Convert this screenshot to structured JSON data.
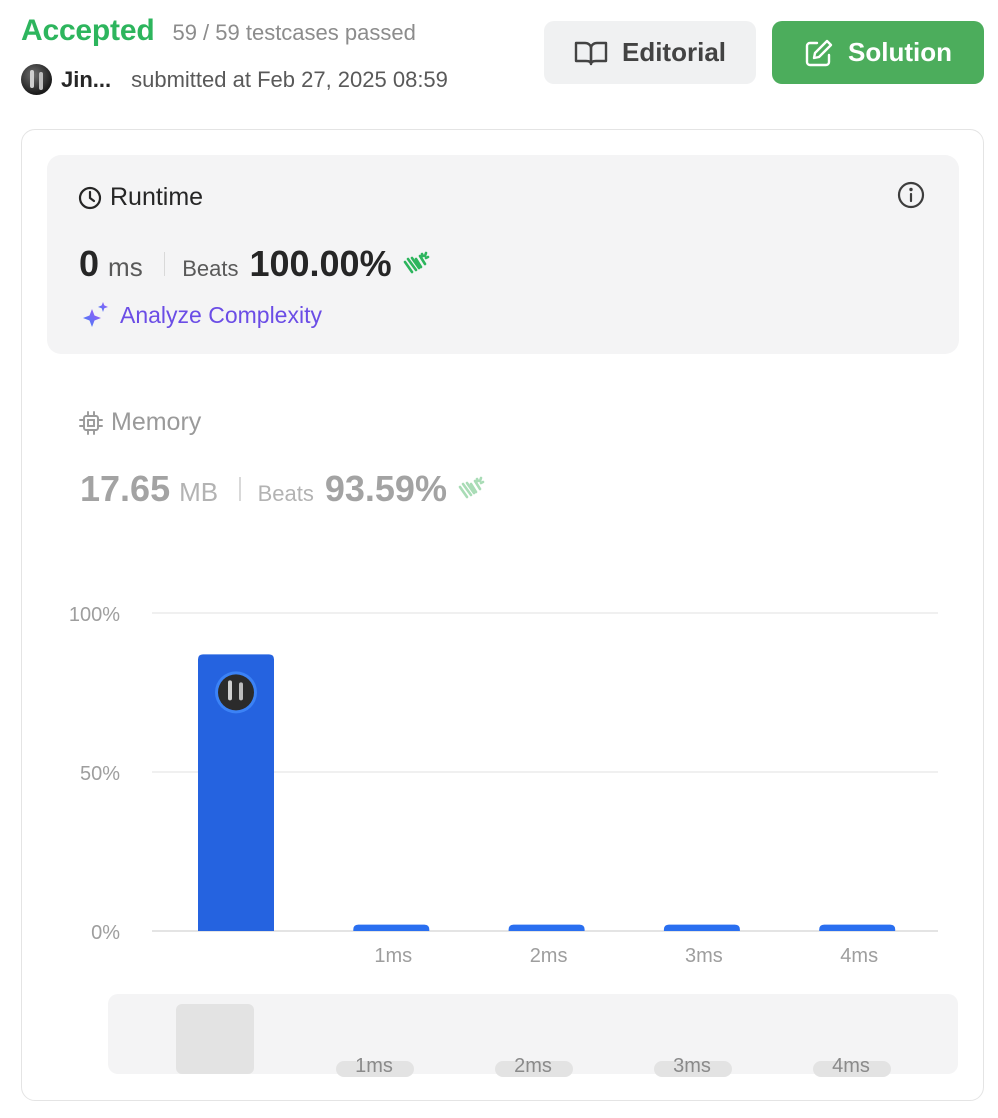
{
  "header": {
    "status": "Accepted",
    "testcases": "59 / 59 testcases passed",
    "username": "Jin...",
    "submitted": "submitted at Feb 27, 2025 08:59",
    "editorial_label": "Editorial",
    "solution_label": "Solution"
  },
  "runtime": {
    "title": "Runtime",
    "value": "0",
    "unit": "ms",
    "beats_label": "Beats",
    "beats_value": "100.00%",
    "analyze_label": "Analyze Complexity"
  },
  "memory": {
    "title": "Memory",
    "value": "17.65",
    "unit": "MB",
    "beats_label": "Beats",
    "beats_value": "93.59%"
  },
  "colors": {
    "accepted": "#2db55d",
    "solution_button": "#4cad5c",
    "bar": "#2563e0",
    "analyze": "#6b4de6"
  },
  "icons": {
    "editorial": "book-open-icon",
    "solution": "edit-icon",
    "runtime": "clock-icon",
    "info": "info-icon",
    "analyze": "sparkle-icon",
    "memory": "cpu-chip-icon",
    "beats": "clapping-hands-icon"
  },
  "chart_data": {
    "type": "bar",
    "categories": [
      "",
      "1ms",
      "2ms",
      "3ms",
      "4ms"
    ],
    "values": [
      87,
      2,
      2,
      2,
      2
    ],
    "y_ticks": [
      "100%",
      "50%",
      "0%"
    ],
    "ylim": [
      0,
      100
    ],
    "grid": true,
    "highlight_index": 0,
    "navigator_labels": [
      "1ms",
      "2ms",
      "3ms",
      "4ms"
    ]
  }
}
